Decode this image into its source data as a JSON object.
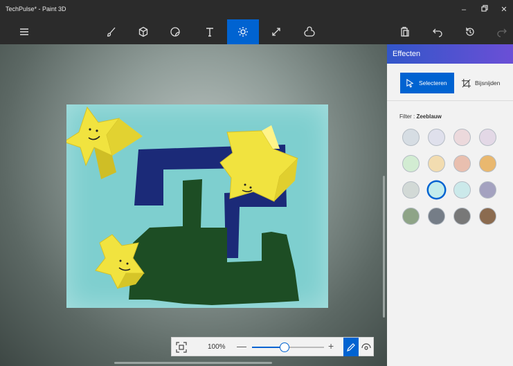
{
  "window": {
    "title": "TechPulse* - Paint 3D",
    "minimize_icon": "minimize-icon",
    "restore_icon": "restore-icon",
    "close_icon": "close-icon"
  },
  "toolbar": {
    "tools": [
      {
        "name": "menu",
        "icon": "hamburger-icon"
      },
      {
        "name": "brushes",
        "icon": "brush-icon"
      },
      {
        "name": "3d-shapes",
        "icon": "cube-icon"
      },
      {
        "name": "stickers",
        "icon": "sticker-icon"
      },
      {
        "name": "text",
        "icon": "text-icon"
      },
      {
        "name": "effects",
        "icon": "sun-icon",
        "active": true
      },
      {
        "name": "canvas",
        "icon": "canvas-resize-icon"
      },
      {
        "name": "3d-library",
        "icon": "library-icon"
      },
      {
        "name": "paste",
        "icon": "paste-icon"
      },
      {
        "name": "undo",
        "icon": "undo-icon"
      },
      {
        "name": "history",
        "icon": "history-icon"
      },
      {
        "name": "redo",
        "icon": "redo-icon"
      }
    ]
  },
  "zoom": {
    "percent_label": "100%",
    "minus": "—",
    "plus": "+",
    "level": 0.45
  },
  "panel": {
    "title": "Effecten",
    "select_label": "Selecteren",
    "crop_label": "Bijsnijden",
    "filter_prefix": "Filter : ",
    "filter_name": "Zeeblauw",
    "swatches": [
      "#d6dde3",
      "#dfe0ec",
      "#ecd9dc",
      "#e3d8e6",
      "#d2ecd2",
      "#f2dcb0",
      "#e9bfaf",
      "#e9b86f",
      "#d2d9d6",
      "#c3ecec",
      "#cbe9ea",
      "#a4a2c0",
      "#8ea487",
      "#757d87",
      "#787878",
      "#8b6b4f"
    ],
    "selected_swatch": 9
  },
  "colors": {
    "accent": "#0063d1",
    "canvas": "#7ecfcf",
    "maze_blue": "#1b2a78",
    "maze_green": "#1d4d24",
    "star_yellow": "#f1e33f"
  }
}
